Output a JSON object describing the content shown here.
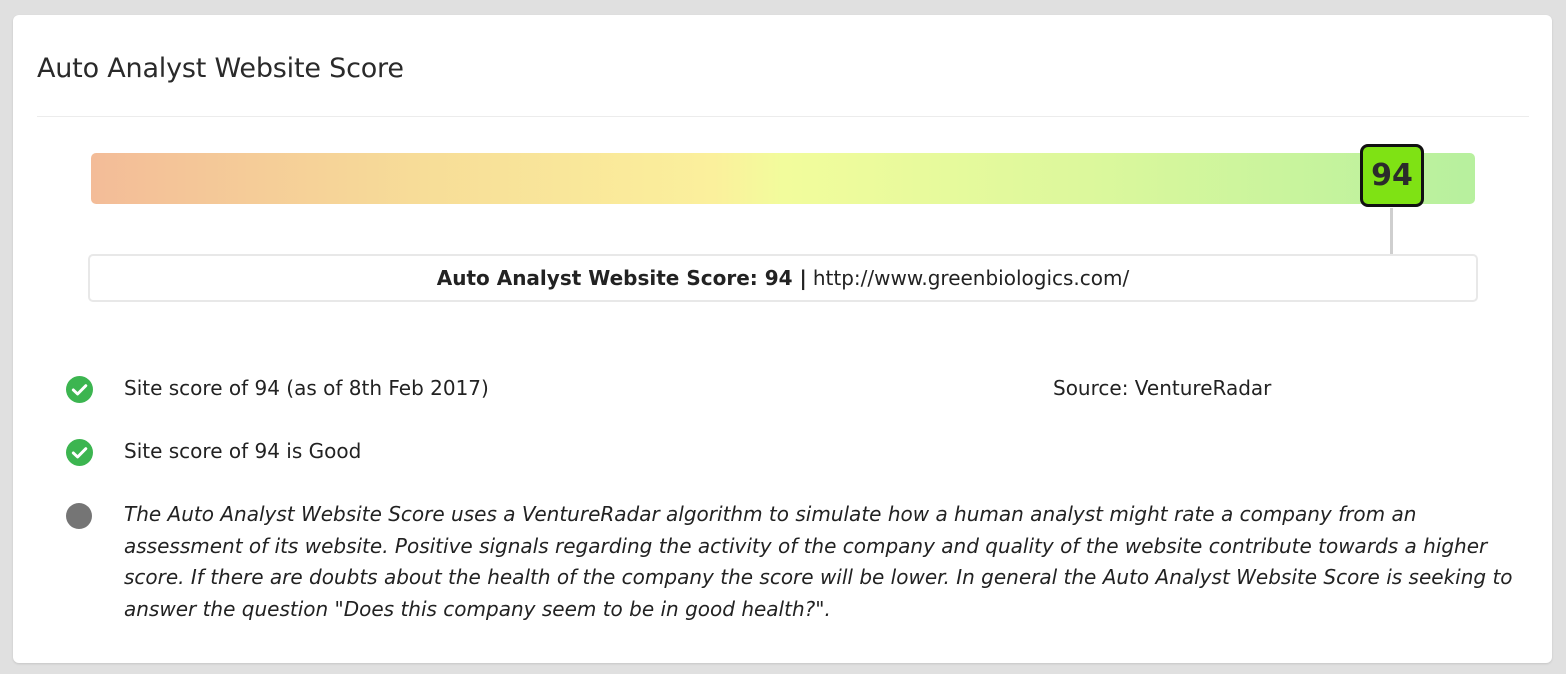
{
  "card": {
    "title": "Auto Analyst Website Score"
  },
  "score": {
    "value": 94,
    "display": "94",
    "range": [
      0,
      100
    ],
    "gradient_colors": [
      "#f3bc98",
      "#f7dd98",
      "#fbf09c",
      "#f2fc9c",
      "#dcf89c",
      "#b7f09e"
    ],
    "badge_color": "#7fe214"
  },
  "caption": {
    "label": "Auto Analyst Website Score: 94",
    "separator": "|",
    "url": "http://www.greenbiologics.com/"
  },
  "items": [
    {
      "icon": "check-circle-icon",
      "text": "Site score of 94 (as of 8th Feb 2017)"
    },
    {
      "icon": "check-circle-icon",
      "text": "Site score of 94 is Good"
    }
  ],
  "source": "Source: VentureRadar",
  "note": {
    "icon": "gray-dot-icon",
    "text": "The Auto Analyst Website Score uses a VentureRadar algorithm to simulate how a human analyst might rate a company from an assessment of its website. Positive signals regarding the activity of the company and quality of the website contribute towards a higher score. If there are doubts about the health of the company the score will be lower. In general the Auto Analyst Website Score is seeking to answer the question \"Does this company seem to be in good health?\"."
  },
  "colors": {
    "check_green": "#3cb550",
    "note_dot": "#757575"
  }
}
